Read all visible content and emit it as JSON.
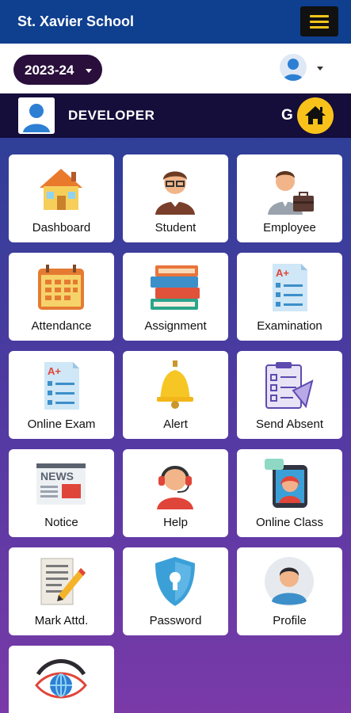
{
  "app": {
    "title": "St. Xavier School"
  },
  "session": {
    "year": "2023-24"
  },
  "user": {
    "name": "DEVELOPER",
    "g_label": "G"
  },
  "tiles": [
    {
      "label": "Dashboard",
      "icon": "house-icon"
    },
    {
      "label": "Student",
      "icon": "student-icon"
    },
    {
      "label": "Employee",
      "icon": "employee-icon"
    },
    {
      "label": "Attendance",
      "icon": "calendar-icon"
    },
    {
      "label": "Assignment",
      "icon": "books-icon"
    },
    {
      "label": "Examination",
      "icon": "exam-sheet-icon"
    },
    {
      "label": "Online Exam",
      "icon": "online-exam-icon"
    },
    {
      "label": "Alert",
      "icon": "bell-icon"
    },
    {
      "label": "Send Absent",
      "icon": "send-absent-icon"
    },
    {
      "label": "Notice",
      "icon": "newspaper-icon"
    },
    {
      "label": "Help",
      "icon": "headset-icon"
    },
    {
      "label": "Online Class",
      "icon": "video-call-icon"
    },
    {
      "label": "Mark Attd.",
      "icon": "pencil-document-icon"
    },
    {
      "label": "Password",
      "icon": "shield-keyhole-icon"
    },
    {
      "label": "Profile",
      "icon": "profile-icon"
    },
    {
      "label": "",
      "icon": "eye-globe-icon"
    }
  ],
  "colors": {
    "appbar": "#0f3f8f",
    "accent_yellow": "#f9c21b",
    "user_bar": "#150d3a",
    "year_pill": "#2a0f3d"
  }
}
